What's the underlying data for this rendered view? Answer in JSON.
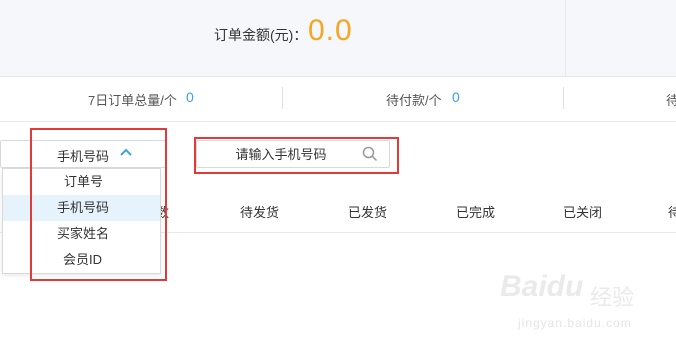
{
  "summary": {
    "amount_label": "订单金额(元)：",
    "amount_value": "0.0"
  },
  "stats": [
    {
      "label": "7日订单总量/个",
      "value": "0"
    },
    {
      "label": "待付款/个",
      "value": "0"
    },
    {
      "label": "待"
    }
  ],
  "search": {
    "type_selected": "手机号码",
    "placeholder": "请输入手机号码"
  },
  "dropdown": {
    "options": [
      "订单号",
      "手机号码",
      "买家姓名",
      "会员ID"
    ],
    "active": "手机号码"
  },
  "tabs": [
    "数",
    "待发货",
    "已发货",
    "已完成",
    "已关闭",
    "待"
  ],
  "watermark": {
    "brand": "Baidu",
    "cn": "经验",
    "url": "jingyan.baidu.com"
  },
  "colors": {
    "accent_orange": "#f5a623",
    "accent_blue": "#3aa3e3",
    "highlight_red": "#e23a3a"
  }
}
